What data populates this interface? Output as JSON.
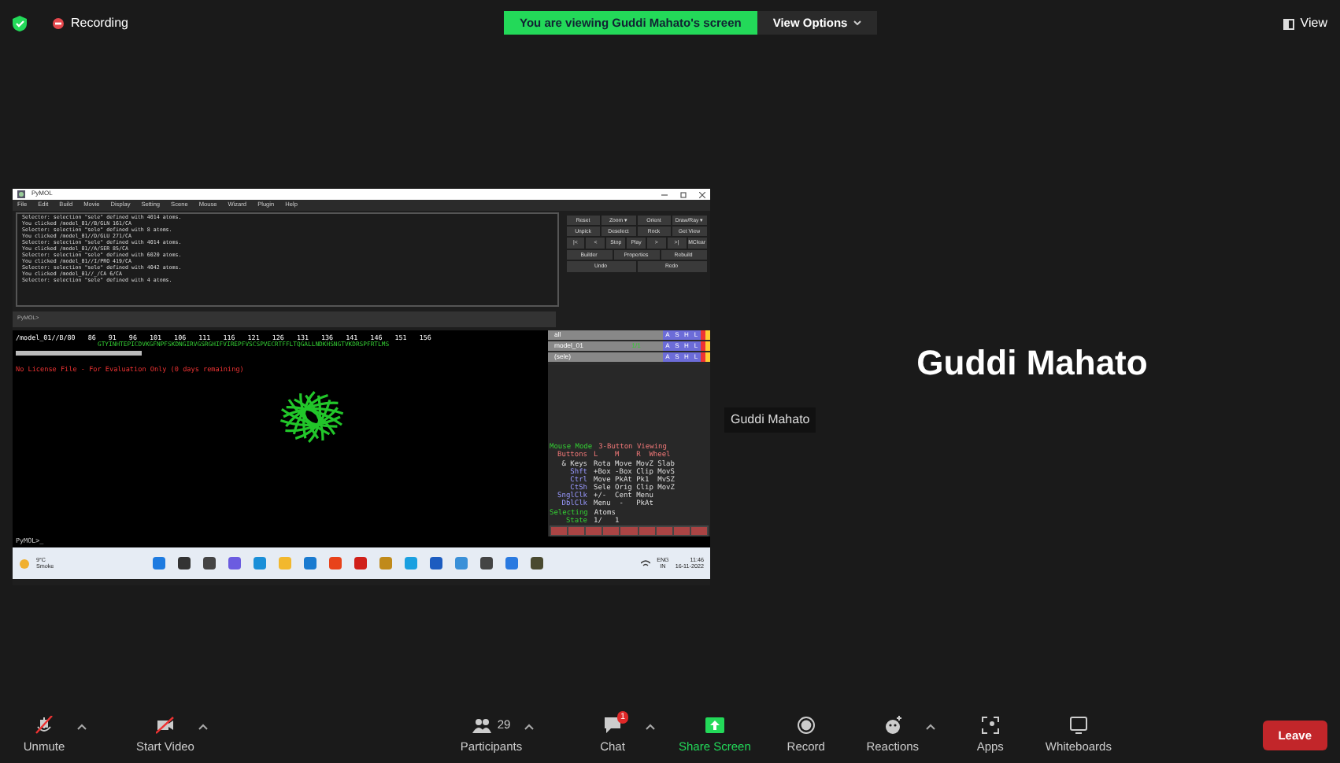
{
  "top_bar": {
    "recording_label": "Recording",
    "banner": "You are viewing Guddi Mahato's screen",
    "view_options": "View Options",
    "view": "View"
  },
  "shared_screen": {
    "window_title": "PyMOL",
    "menu": [
      "File",
      "Edit",
      "Build",
      "Movie",
      "Display",
      "Setting",
      "Scene",
      "Mouse",
      "Wizard",
      "Plugin",
      "Help"
    ],
    "log": [
      "Selector: selection \"sele\" defined with 4014 atoms.",
      "You clicked /model_01//B/GLN 161/CA",
      "Selector: selection \"sele\" defined with 8 atoms.",
      "You clicked /model_01//D/GLU 271/CA",
      "Selector: selection \"sele\" defined with 4014 atoms.",
      "You clicked /model_01//A/SER 85/CA",
      "Selector: selection \"sele\" defined with 6020 atoms.",
      "You clicked /model_01//I/PRO 419/CA",
      "Selector: selection \"sele\" defined with 4042 atoms.",
      "You clicked /model_01//_/CA 6/CA",
      "Selector: selection \"sele\" defined with 4 atoms."
    ],
    "button_rows": [
      [
        "Reset",
        "Zoom ▾",
        "Orient",
        "Draw/Ray ▾"
      ],
      [
        "Unpick",
        "Deselect",
        "Rock",
        "Get View"
      ],
      [
        "|<",
        "<",
        "Stop",
        "Play",
        ">",
        ">|",
        "MClear"
      ],
      [
        "Builder",
        "Properties",
        "Rebuild"
      ],
      [
        "Undo",
        "Redo"
      ]
    ],
    "command_prompt": "PyMOL>",
    "sequence": {
      "header": "/model_01//B/80",
      "numbers": [
        "86",
        "91",
        "96",
        "101",
        "106",
        "111",
        "116",
        "121",
        "126",
        "131",
        "136",
        "141",
        "146",
        "151",
        "156"
      ],
      "residues": "GTYINHTEPICDVKGFNPFSKDNGIRVGSRGHIFVIREPFVSCSPVECRTFFLTQGALLNDKHSNGTVKDRSPFRTLMS"
    },
    "license_notice": "No License File - For Evaluation Only (0 days remaining)",
    "objects": [
      {
        "name": "all",
        "buttons": [
          "A",
          "S",
          "H",
          "L"
        ]
      },
      {
        "name": "model_01",
        "states": "1/1",
        "buttons": [
          "A",
          "S",
          "H",
          "L"
        ]
      },
      {
        "name": "(sele)",
        "buttons": [
          "A",
          "S",
          "H",
          "L"
        ]
      }
    ],
    "mouse_mode": [
      [
        "Mouse Mode",
        "3-Button Viewing"
      ],
      [
        "Buttons",
        "L    M    R  Wheel"
      ],
      [
        "& Keys",
        "Rota Move MovZ Slab"
      ],
      [
        "Shft",
        "+Box -Box Clip MovS"
      ],
      [
        "Ctrl",
        "Move PkAt Pk1  MvSZ"
      ],
      [
        "CtSh",
        "Sele Orig Clip MovZ"
      ],
      [
        "SnglClk",
        "+/-  Cent Menu"
      ],
      [
        "DblClk",
        "Menu  -   PkAt"
      ],
      [
        "Selecting",
        "Atoms"
      ],
      [
        "State",
        "1/   1"
      ]
    ],
    "bottom_prompt": "PyMOL>_",
    "taskbar": {
      "temperature": "9°C",
      "weather": "Smoke",
      "language": "ENG",
      "region": "IN",
      "time": "11:46",
      "date": "16-11-2022"
    }
  },
  "participant": {
    "name": "Guddi Mahato",
    "name_tag": "Guddi Mahato"
  },
  "toolbar": [
    {
      "kind": "mic",
      "label": "Unmute",
      "caret": true,
      "active": false
    },
    {
      "kind": "video",
      "label": "Start Video",
      "caret": true,
      "active": false
    },
    {
      "kind": "participants",
      "label": "Participants",
      "count": "29",
      "caret": true,
      "active": false
    },
    {
      "kind": "chat",
      "label": "Chat",
      "badge": "1",
      "caret": true,
      "active": false
    },
    {
      "kind": "share",
      "label": "Share Screen",
      "caret": false,
      "active": true
    },
    {
      "kind": "record",
      "label": "Record",
      "caret": false,
      "active": false
    },
    {
      "kind": "reactions",
      "label": "Reactions",
      "caret": true,
      "active": false
    },
    {
      "kind": "apps",
      "label": "Apps",
      "caret": false,
      "active": false
    },
    {
      "kind": "whiteboard",
      "label": "Whiteboards",
      "caret": false,
      "active": false
    }
  ],
  "leave": "Leave"
}
